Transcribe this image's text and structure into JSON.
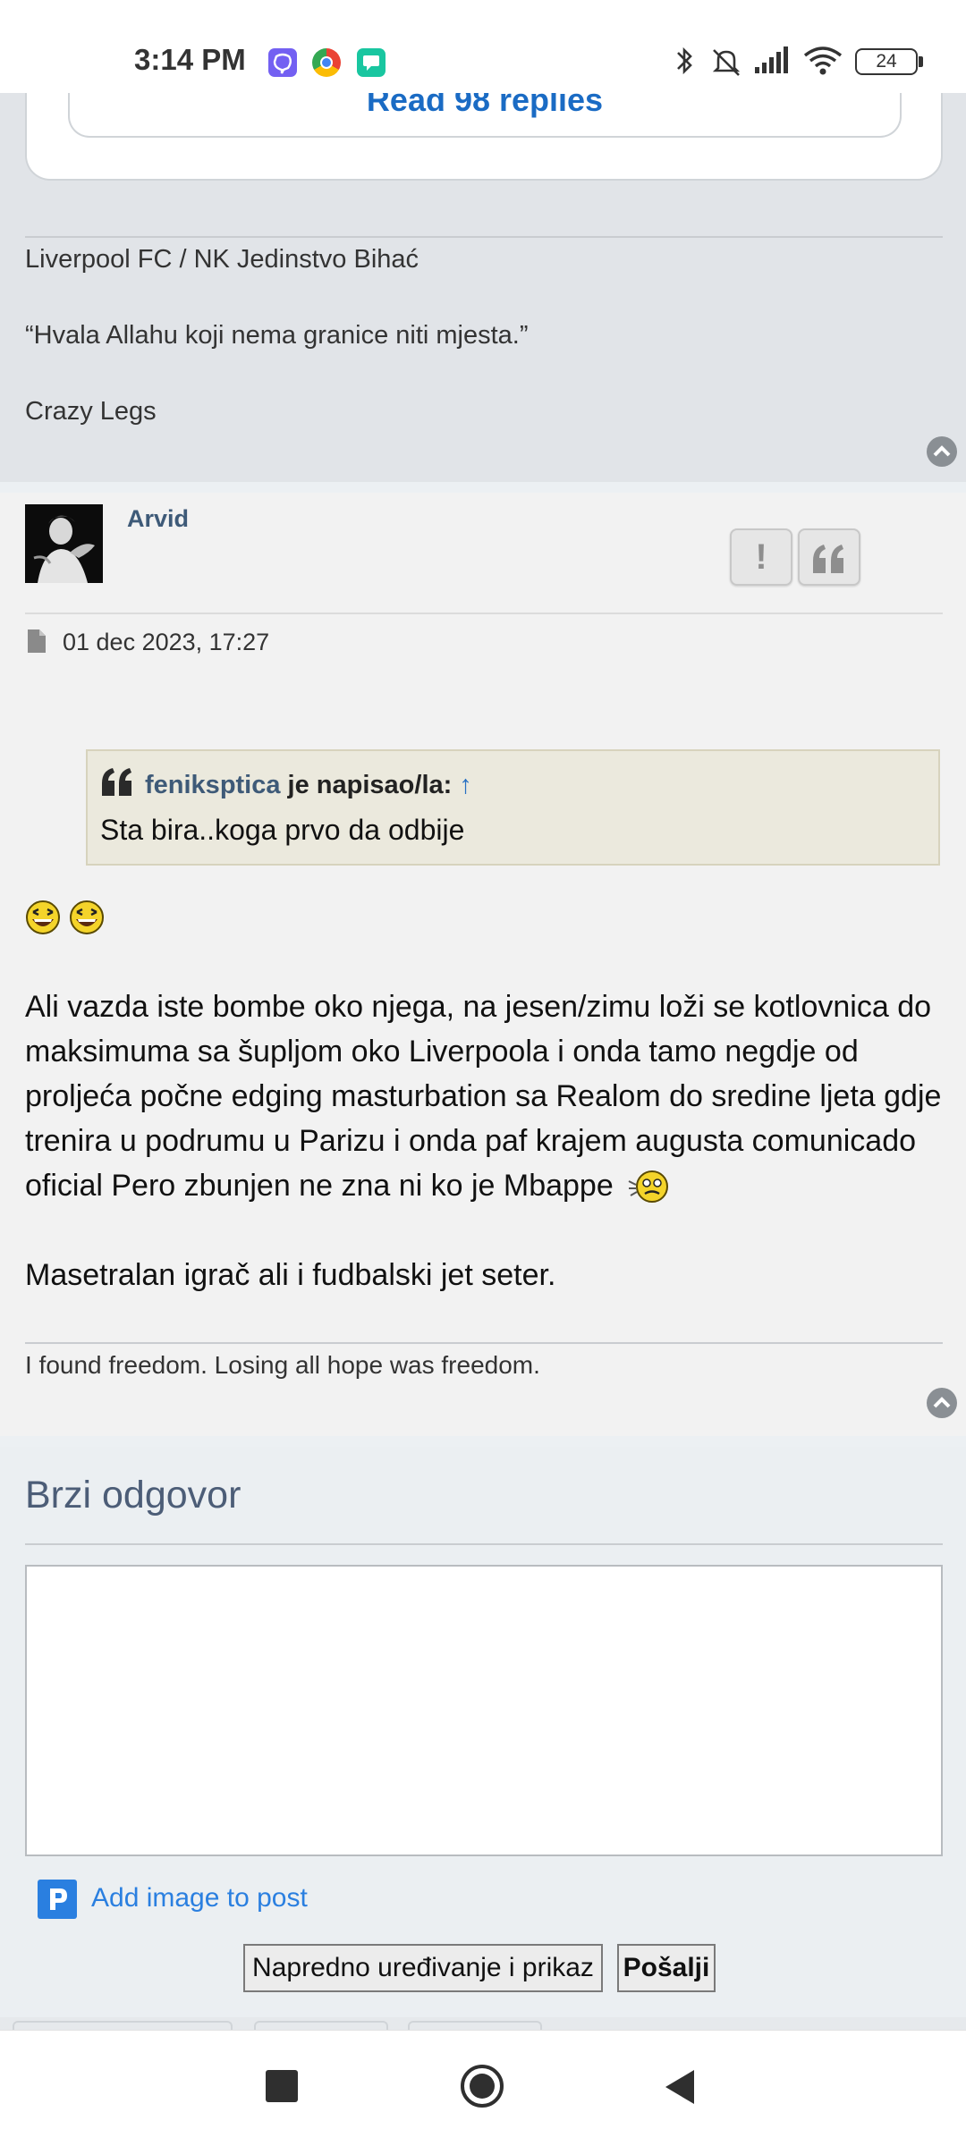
{
  "status_bar": {
    "time": "3:14 PM",
    "app_icons": [
      "viber-icon",
      "chrome-icon",
      "messages-icon"
    ],
    "battery": "24"
  },
  "previous_post": {
    "replies_button": "Read 98 replies",
    "signature": [
      "Liverpool FC / NK Jedinstvo Bihać",
      "“Hvala Allahu koji nema granice niti mjesta.”",
      "Crazy Legs"
    ]
  },
  "post": {
    "author": "Arvid",
    "report_label": "!",
    "date": "01 dec 2023, 17:27",
    "quote": {
      "author": "feniksptica",
      "says": " je napisao/la: ",
      "arrow": "↑",
      "text": "Sta bira..koga prvo da odbije"
    },
    "paragraphs": [
      "Ali vazda iste bombe oko njega, na jesen/zimu loži se kotlovnica do maksimuma sa šupljom oko Liverpoola i onda tamo negdje od proljeća počne edging masturbation sa Realom do sredine ljeta gdje trenira u podrumu u Parizu i onda paf krajem augusta comunicado oficial Pero zbunjen ne zna ni ko je Mbappe",
      "Masetralan igrač ali i fudbalski jet seter."
    ],
    "signature": "I found freedom. Losing all hope was freedom."
  },
  "quick_reply": {
    "title": "Brzi odgovor",
    "textarea_value": "",
    "add_image": "Add image to post",
    "advanced_button": "Napredno uređivanje i prikaz",
    "submit_button": "Pošalji"
  },
  "colors": {
    "link": "#3e5a78",
    "accent": "#2a7fe0",
    "quote_bg": "#ebe9dd"
  }
}
